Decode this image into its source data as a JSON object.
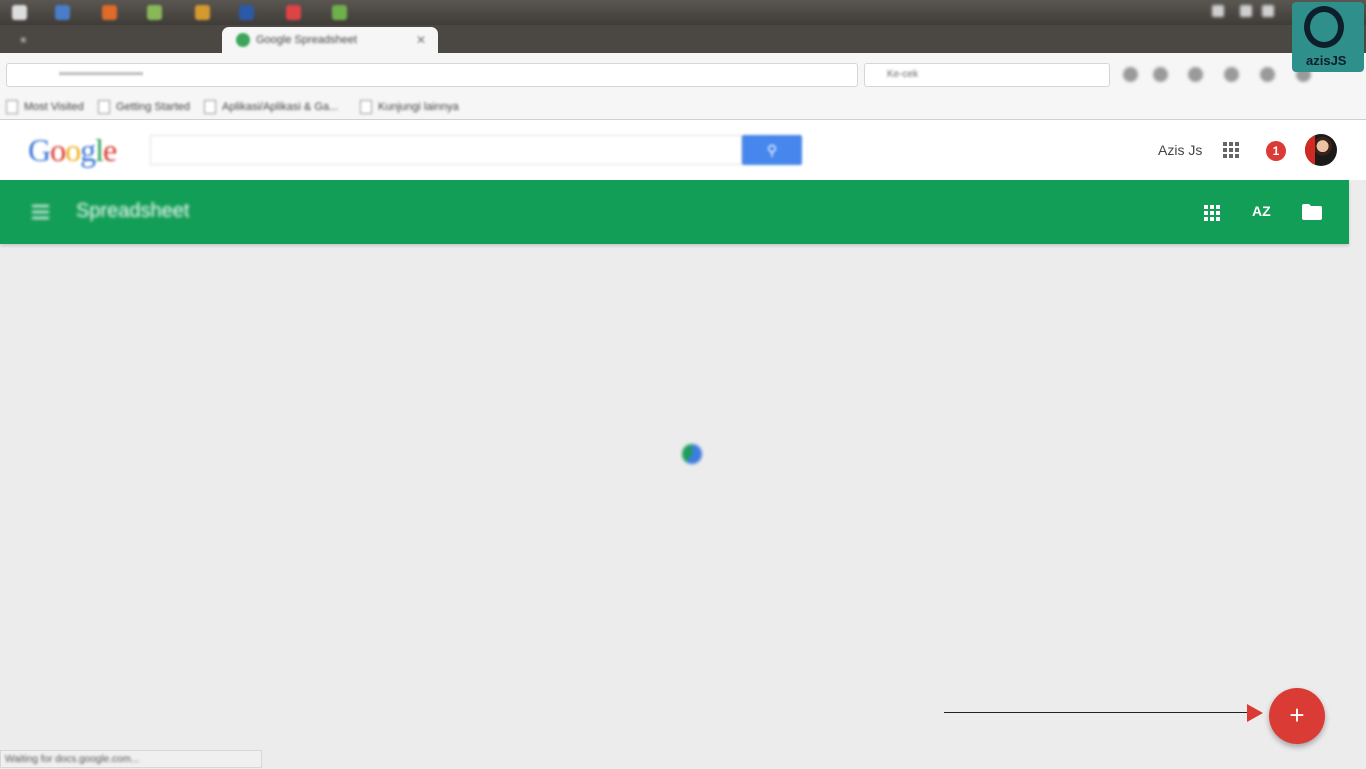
{
  "browser": {
    "tabs": [
      {
        "label": "Google Spreadsheet",
        "active": true
      }
    ],
    "search_engine_placeholder": "Ke-cek",
    "bookmarks": [
      "Most Visited",
      "Getting Started",
      "Aplikasi/Aplikasi & Ga...",
      "Kunjungi lainnya"
    ]
  },
  "google_header": {
    "logo_letters": [
      {
        "ch": "G",
        "color": "#3c78d8"
      },
      {
        "ch": "o",
        "color": "#d83c2f"
      },
      {
        "ch": "o",
        "color": "#f2b01e"
      },
      {
        "ch": "g",
        "color": "#3c78d8"
      },
      {
        "ch": "l",
        "color": "#2fa24f"
      },
      {
        "ch": "e",
        "color": "#d83c2f"
      }
    ],
    "user_name": "Azis Js",
    "notification_count": "1"
  },
  "app_bar": {
    "title": "Spreadsheet",
    "color": "#129e56",
    "sort_label": "AZ"
  },
  "content": {
    "loading": true
  },
  "fab": {
    "label": "+",
    "color": "#db3b35"
  },
  "status_bar": {
    "text": "Waiting for docs.google.com..."
  },
  "watermark": {
    "text": "azisJS"
  }
}
